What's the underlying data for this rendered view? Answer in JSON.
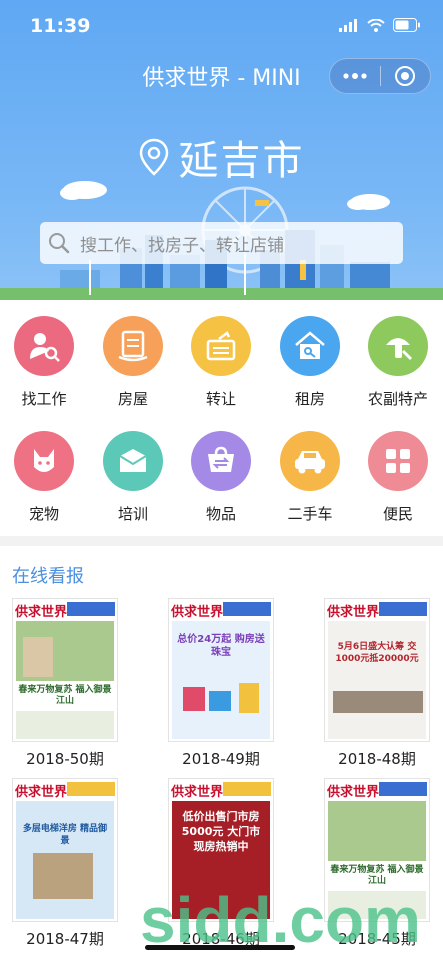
{
  "status_bar": {
    "time": "11:39"
  },
  "header": {
    "title": "供求世界 - MINI",
    "city": "延吉市"
  },
  "search": {
    "placeholder": "搜工作、找房子、转让店铺"
  },
  "categories": [
    {
      "label": "找工作",
      "icon": "job-search-icon",
      "color": "#ec6a7f"
    },
    {
      "label": "房屋",
      "icon": "house-doc-icon",
      "color": "#f6a05a"
    },
    {
      "label": "转让",
      "icon": "transfer-icon",
      "color": "#f6c244"
    },
    {
      "label": "租房",
      "icon": "rent-house-icon",
      "color": "#4aa6ee"
    },
    {
      "label": "农副特产",
      "icon": "farm-produce-icon",
      "color": "#8dc95c"
    },
    {
      "label": "宠物",
      "icon": "pet-icon",
      "color": "#ee7283"
    },
    {
      "label": "培训",
      "icon": "training-icon",
      "color": "#5cc9b8"
    },
    {
      "label": "物品",
      "icon": "goods-icon",
      "color": "#a48ae6"
    },
    {
      "label": "二手车",
      "icon": "used-car-icon",
      "color": "#f6b748"
    },
    {
      "label": "便民",
      "icon": "services-icon",
      "color": "#ee8b94"
    }
  ],
  "newspapers": {
    "section_title": "在线看报",
    "masthead": "供求世界",
    "issues": [
      {
        "label": "2018-50期",
        "headline": "春来万物复苏 福入御景江山",
        "theme": "#6aa56a"
      },
      {
        "label": "2018-49期",
        "headline": "总价24万起 购房送珠宝",
        "theme": "#3a84c8"
      },
      {
        "label": "2018-48期",
        "headline": "5月6日盛大认筹 交1000元抵20000元",
        "theme": "#9a8a7a"
      },
      {
        "label": "2018-47期",
        "headline": "多层电梯洋房 精品御景",
        "theme": "#4f8fd0"
      },
      {
        "label": "2018-46期",
        "headline": "低价出售门市房 5000元 大门市 现房热销中",
        "theme": "#b8202a"
      },
      {
        "label": "2018-45期",
        "headline": "春来万物复苏 福入御景江山",
        "theme": "#6aa56a"
      }
    ]
  },
  "watermark": {
    "text": "sidd.com"
  }
}
